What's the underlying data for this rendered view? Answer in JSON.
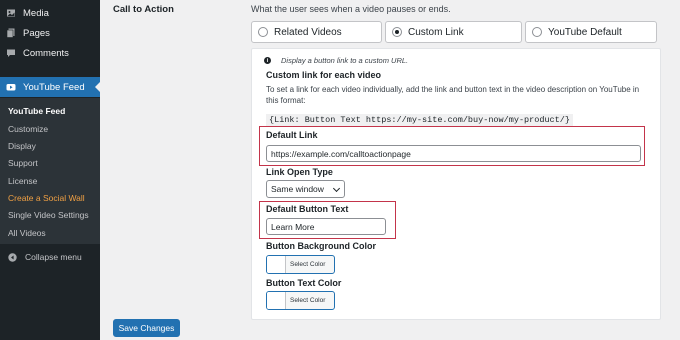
{
  "sidebar": {
    "items": [
      {
        "label": "Media",
        "icon": "media-icon"
      },
      {
        "label": "Pages",
        "icon": "pages-icon"
      },
      {
        "label": "Comments",
        "icon": "comments-icon"
      },
      {
        "label": "YouTube Feed",
        "icon": "youtube-icon"
      }
    ],
    "submenu": [
      "YouTube Feed",
      "Customize",
      "Display",
      "Support",
      "License",
      "Create a Social Wall",
      "Single Video Settings",
      "All Videos"
    ],
    "collapse_label": "Collapse menu"
  },
  "main": {
    "row_label": "Call to Action",
    "row_description": "What the user sees when a video pauses or ends.",
    "options": [
      {
        "label": "Related Videos",
        "selected": false
      },
      {
        "label": "Custom Link",
        "selected": true
      },
      {
        "label": "YouTube Default",
        "selected": false
      }
    ],
    "panel": {
      "info": "Display a button link to a custom URL.",
      "custom_heading": "Custom link for each video",
      "custom_text": "To set a link for each video individually, add the link and button text in the video description on YouTube in this format:",
      "code": "{Link: Button Text https://my-site.com/buy-now/my-product/}",
      "default_link_label": "Default Link",
      "default_link_value": "https://example.com/calltoactionpage",
      "link_open_label": "Link Open Type",
      "link_open_value": "Same window",
      "default_button_label": "Default Button Text",
      "default_button_value": "Learn More",
      "bg_color_label": "Button Background Color",
      "bg_color_button": "Select Color",
      "text_color_label": "Button Text Color",
      "text_color_button": "Select Color"
    },
    "save_label": "Save Changes"
  },
  "colors": {
    "sidebar": "#1d2327",
    "submenu": "#2c3338",
    "accent": "#2271b1",
    "highlight_box": "#c3344a",
    "social_wall": "#f0a044"
  }
}
